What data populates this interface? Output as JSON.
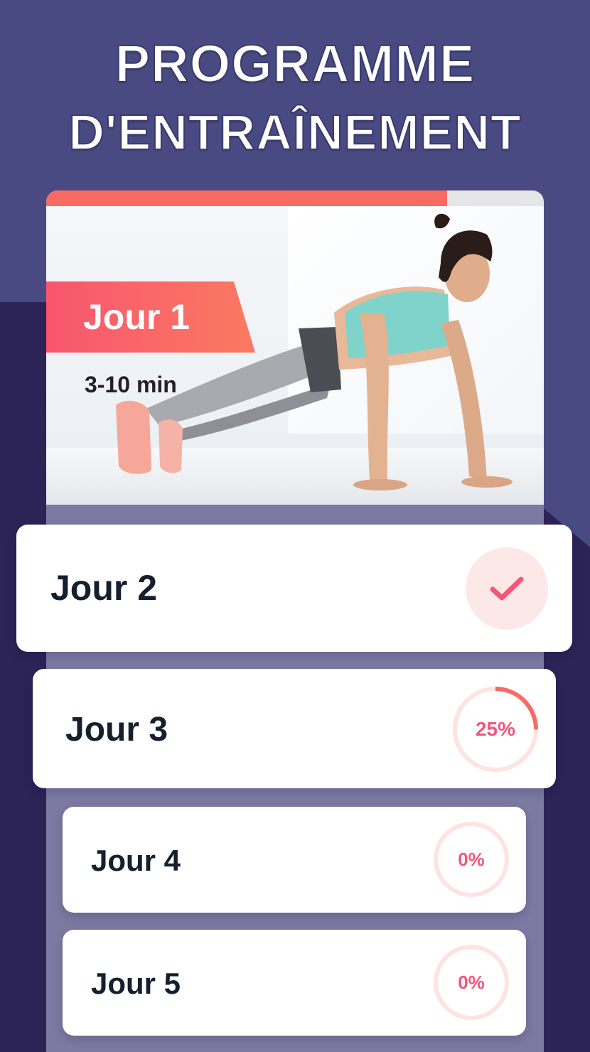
{
  "headline": {
    "line1": "PROGRAMME",
    "line2": "D'ENTRAÎNEMENT"
  },
  "program": {
    "progress_fraction": 0.805,
    "current_day": {
      "title": "Jour 1",
      "duration": "3-10 min"
    },
    "days": [
      {
        "title": "Jour 2",
        "status": "completed",
        "icon": "check-icon"
      },
      {
        "title": "Jour 3",
        "status": "in-progress",
        "percent_label": "25%",
        "fraction": 0.25
      },
      {
        "title": "Jour 4",
        "status": "not-started",
        "percent_label": "0%",
        "fraction": 0
      },
      {
        "title": "Jour 5",
        "status": "not-started",
        "percent_label": "0%",
        "fraction": 0
      }
    ]
  },
  "colors": {
    "accent": "#f86b63",
    "accent_pink": "#f3567a",
    "ring_track": "#fde3e1",
    "background": "#4a4a82",
    "background_dark": "#2c2356"
  }
}
